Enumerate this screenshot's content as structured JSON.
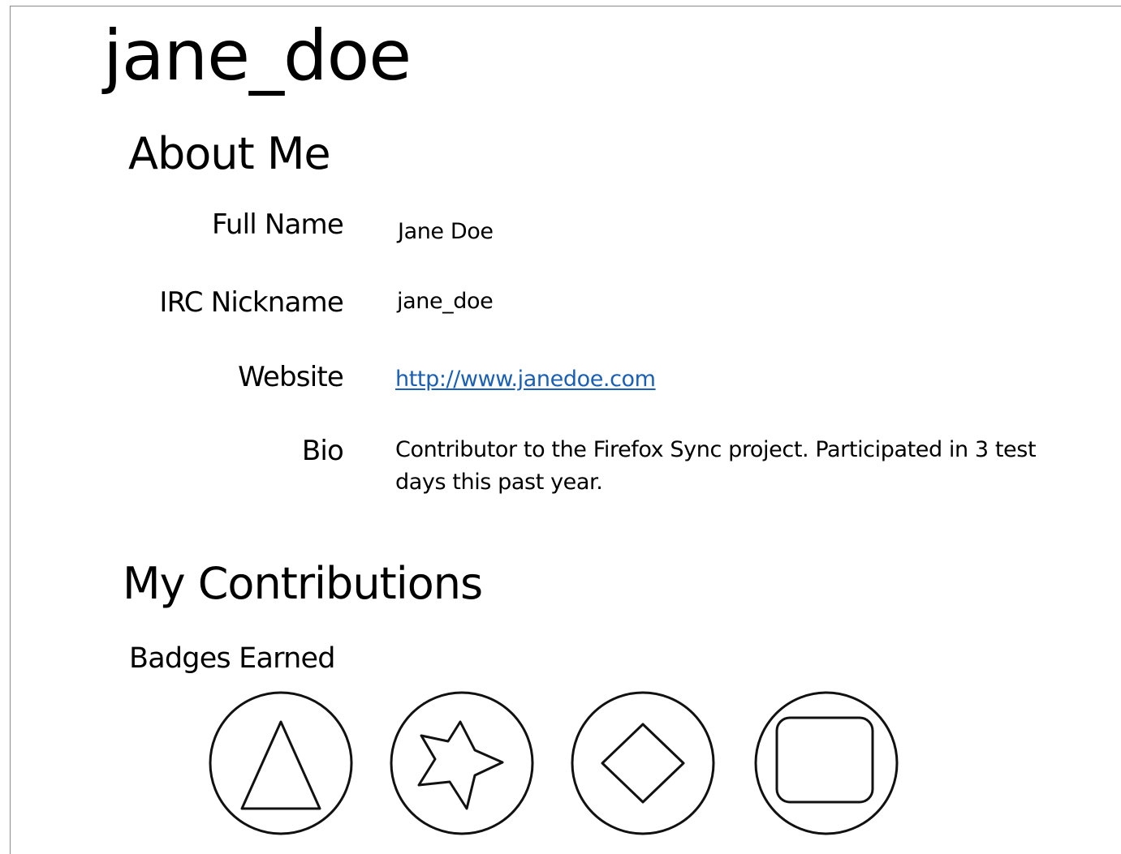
{
  "profile": {
    "username": "jane_doe"
  },
  "about": {
    "heading": "About Me",
    "fields": [
      {
        "label": "Full Name",
        "value": "Jane Doe"
      },
      {
        "label": "IRC Nickname",
        "value": "jane_doe"
      },
      {
        "label": "Website",
        "value": "http://www.janedoe.com"
      },
      {
        "label": "Bio",
        "value": "Contributor to the Firefox Sync project. Participated in 3 test days this past year."
      }
    ]
  },
  "contributions": {
    "heading": "My Contributions",
    "badges_label": "Badges Earned",
    "badges": [
      {
        "icon": "triangle-badge-icon"
      },
      {
        "icon": "star-badge-icon"
      },
      {
        "icon": "diamond-badge-icon"
      },
      {
        "icon": "square-badge-icon"
      }
    ]
  },
  "colors": {
    "link": "#1a5fb4",
    "frame_border": "#8a8a8a"
  }
}
